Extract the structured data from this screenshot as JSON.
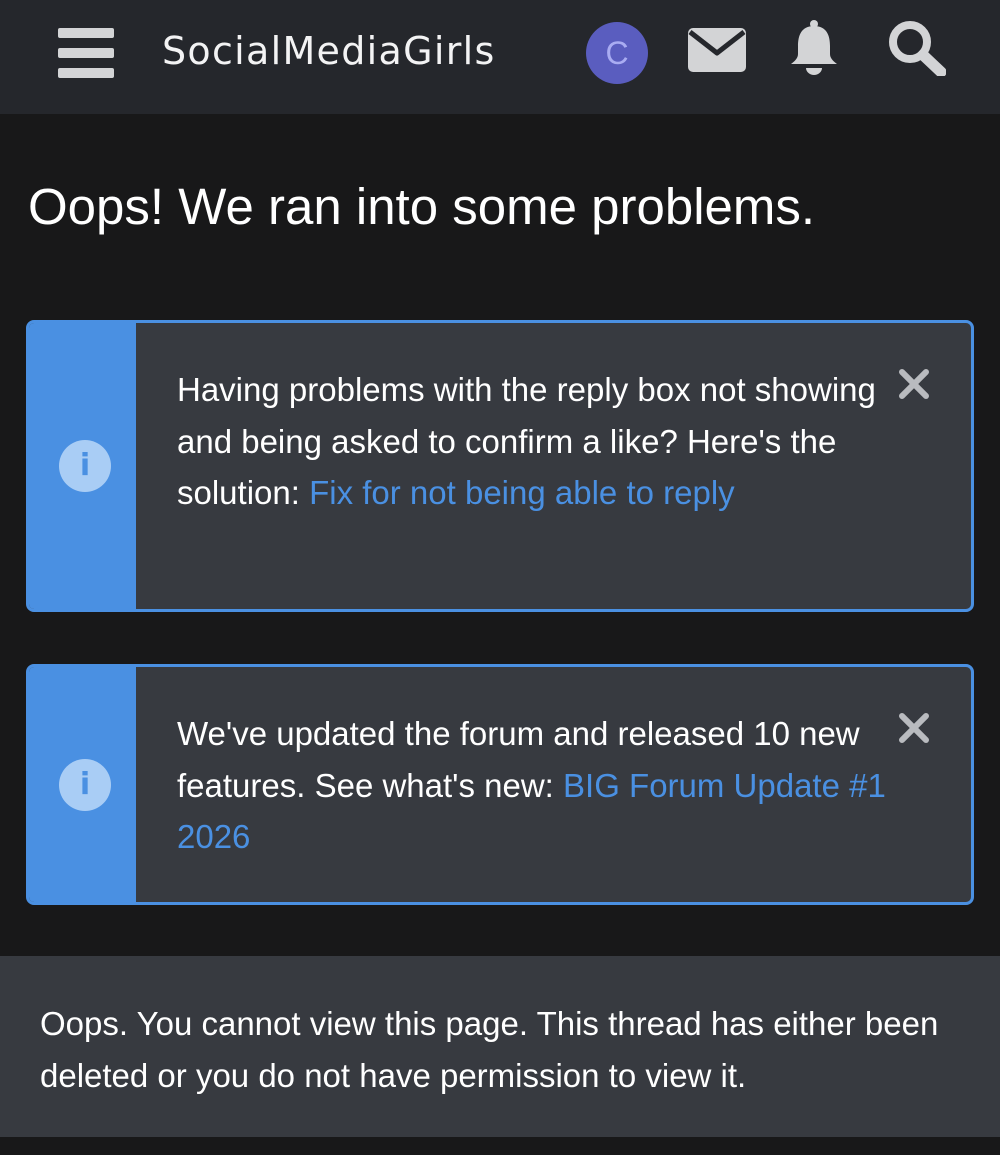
{
  "header": {
    "menu_icon": "hamburger-menu-icon",
    "site_name": "SocialMediaGirls",
    "avatar_letter": "C",
    "avatar_color": "#5a5dbf",
    "icons": [
      "envelope-icon",
      "bell-icon",
      "search-icon"
    ],
    "background_color": "#25272c"
  },
  "page": {
    "title": "Oops! We ran into some problems.",
    "background_color": "#181819"
  },
  "notices": [
    {
      "icon": "info-icon",
      "text": "Having problems with the reply box not showing and being asked to confirm a like? Here's the solution: ",
      "link_text": "Fix for not being able to reply",
      "close_icon": "close-icon"
    },
    {
      "icon": "info-icon",
      "text": "We've updated the forum and released 10 new features. See what's new: ",
      "link_text": "BIG Forum Update #1 2026",
      "close_icon": "close-icon"
    }
  ],
  "error": {
    "message": "Oops. You cannot view this page. This thread has either been deleted or you do not have permission to view it."
  },
  "colors": {
    "accent": "#4a90e2",
    "notice_background": "#373a40",
    "icon_gray": "#d3d4d6"
  }
}
